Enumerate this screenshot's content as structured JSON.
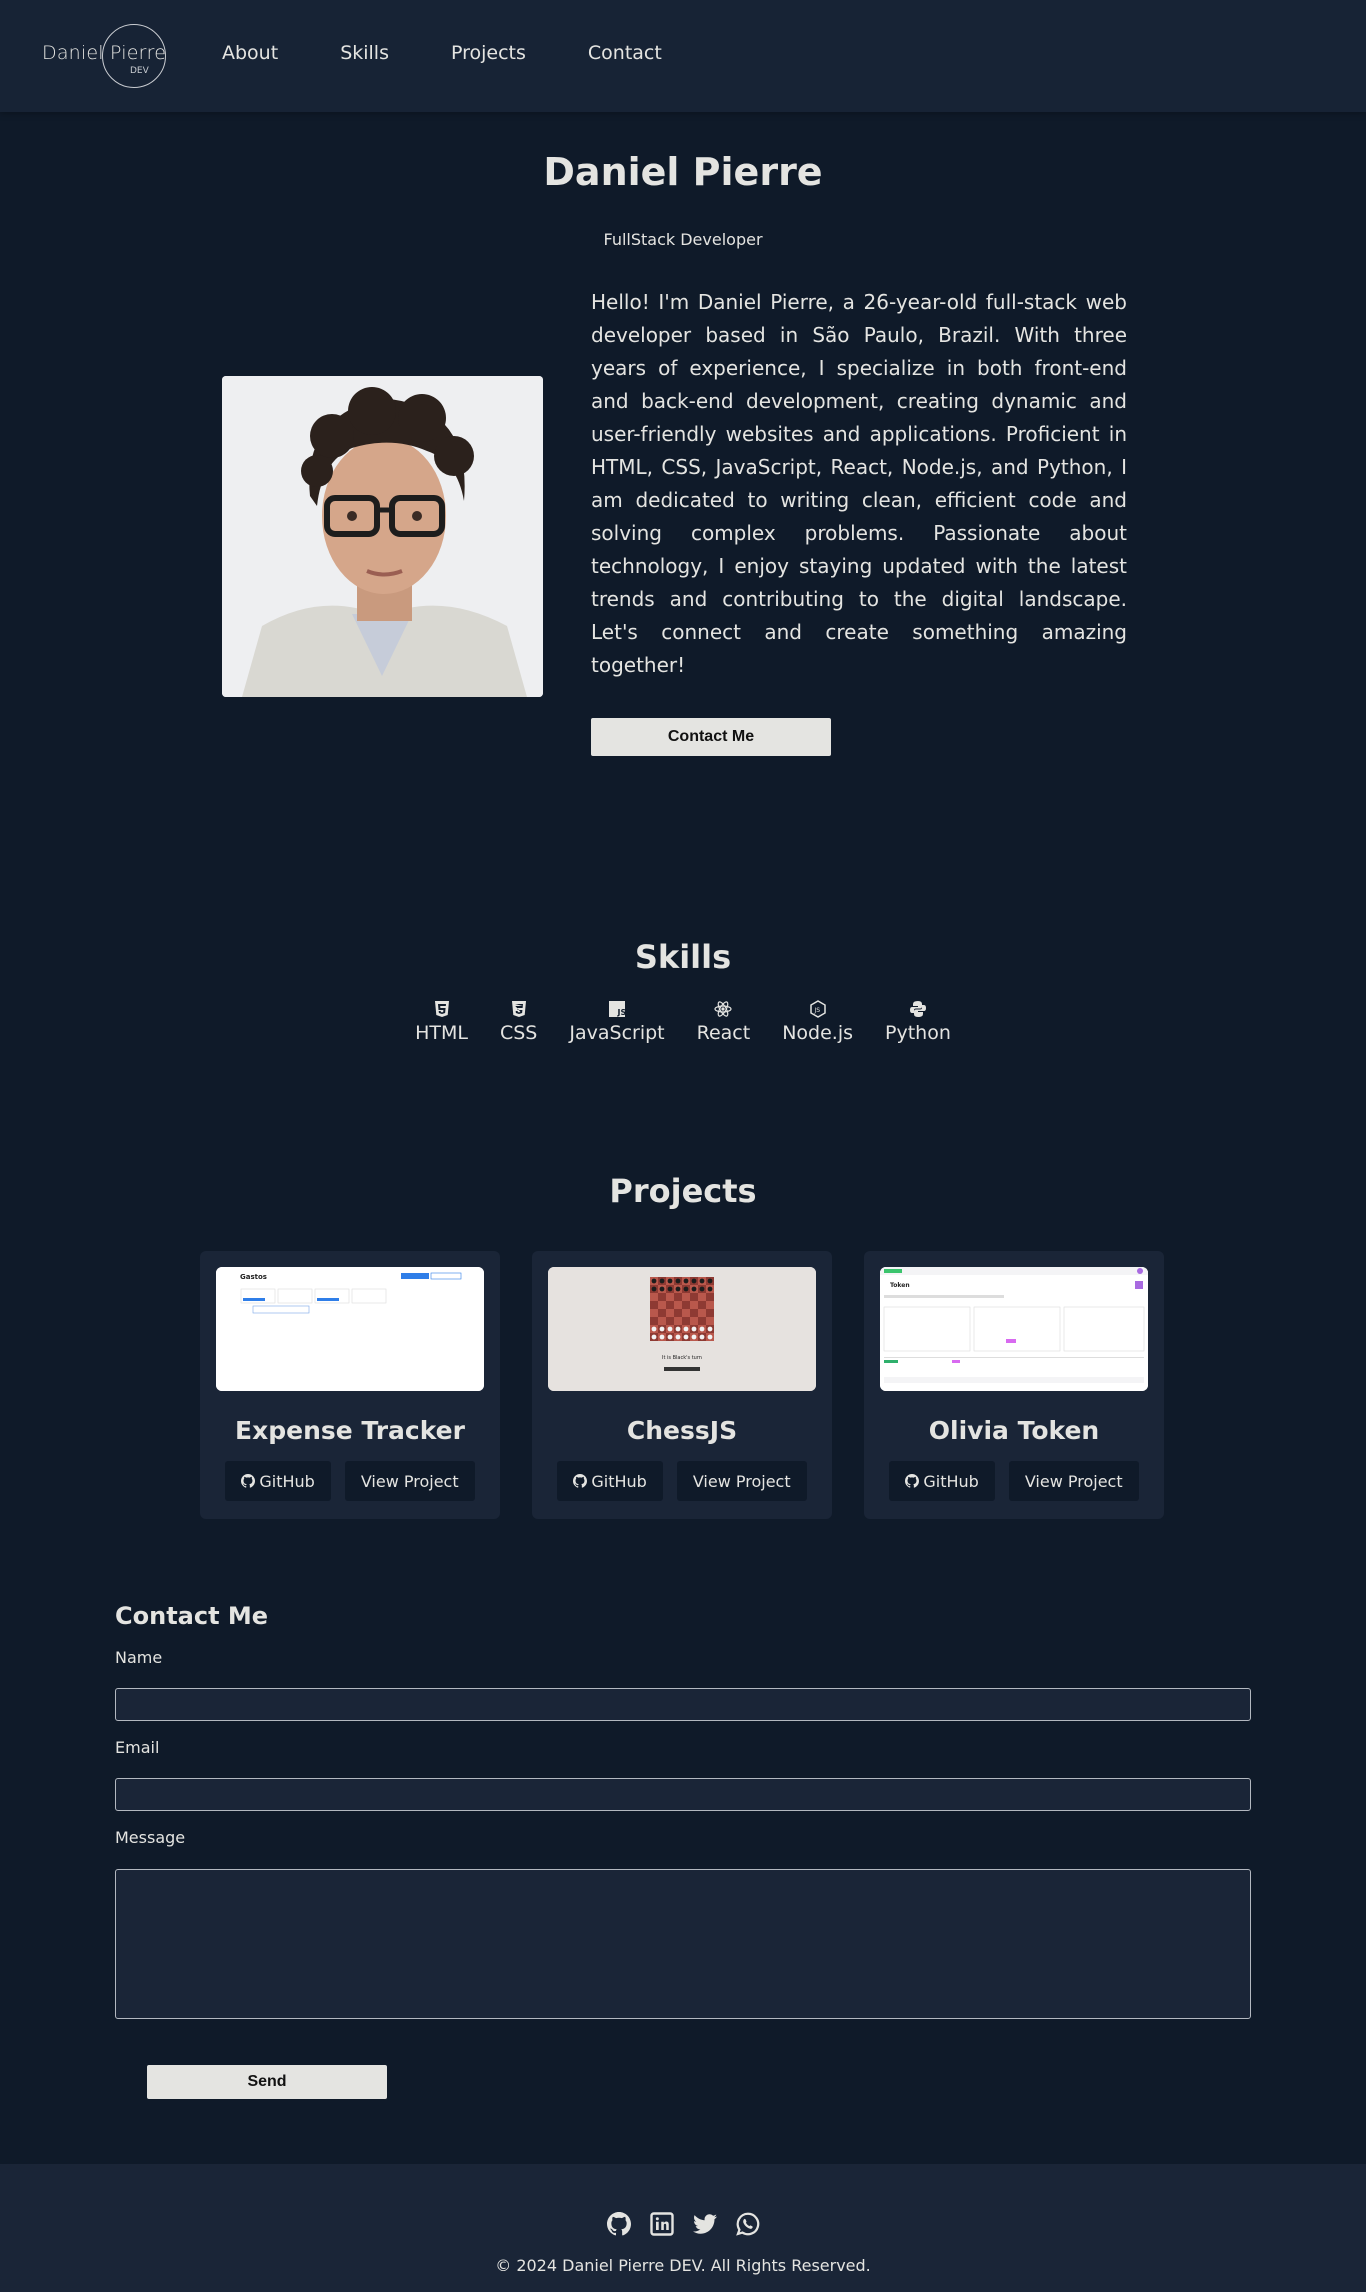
{
  "header": {
    "logo_name": "Daniel Pierre",
    "logo_sub": "DEV",
    "nav": [
      "About",
      "Skills",
      "Projects",
      "Contact"
    ]
  },
  "hero": {
    "name": "Daniel Pierre",
    "role": "FullStack Developer",
    "bio": "Hello! I'm Daniel Pierre, a 26-year-old full-stack web developer based in São Paulo, Brazil. With three years of experience, I specialize in both front-end and back-end development, creating dynamic and user-friendly websites and applications. Proficient in HTML, CSS, JavaScript, React, Node.js, and Python, I am dedicated to writing clean, efficient code and solving complex problems. Passionate about technology, I enjoy staying updated with the latest trends and contributing to the digital landscape. Let's connect and create something amazing together!",
    "contact_button": "Contact Me"
  },
  "skills": {
    "title": "Skills",
    "items": [
      {
        "label": "HTML",
        "icon": "html5-icon"
      },
      {
        "label": "CSS",
        "icon": "css3-icon"
      },
      {
        "label": "JavaScript",
        "icon": "js-icon"
      },
      {
        "label": "React",
        "icon": "react-icon"
      },
      {
        "label": "Node.js",
        "icon": "nodejs-icon"
      },
      {
        "label": "Python",
        "icon": "python-icon"
      }
    ]
  },
  "projects": {
    "title": "Projects",
    "items": [
      {
        "title": "Expense Tracker",
        "github": "GitHub",
        "view": "View Project",
        "thumb_text": "Gastos"
      },
      {
        "title": "ChessJS",
        "github": "GitHub",
        "view": "View Project",
        "thumb_text": "It is Black's turn"
      },
      {
        "title": "Olivia Token",
        "github": "GitHub",
        "view": "View Project",
        "thumb_text": "Token"
      }
    ]
  },
  "contact": {
    "title": "Contact Me",
    "name_label": "Name",
    "email_label": "Email",
    "message_label": "Message",
    "send": "Send"
  },
  "footer": {
    "socials": [
      "github-icon",
      "linkedin-icon",
      "twitter-icon",
      "whatsapp-icon"
    ],
    "copyright": "© 2024 Daniel Pierre DEV. All Rights Reserved."
  },
  "colors": {
    "background": "#0f1a29",
    "surface": "#1a2537",
    "text": "#e4e4e1",
    "button": "#e4e4e1"
  }
}
